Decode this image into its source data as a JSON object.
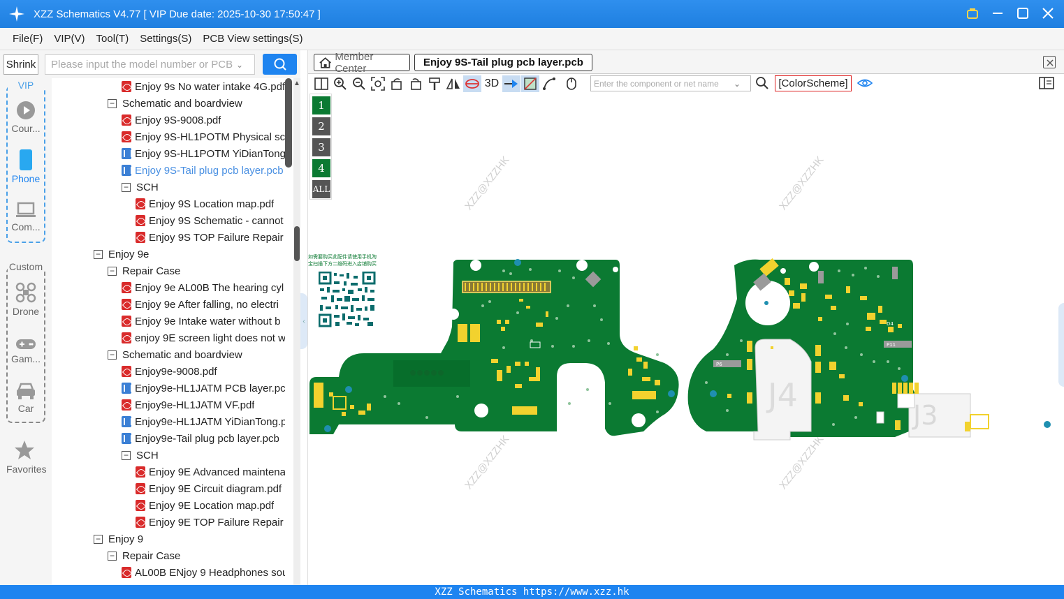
{
  "window": {
    "title": "XZZ Schematics V4.77 [ VIP Due date: 2025-10-30 17:50:47 ]"
  },
  "menu": [
    "File(F)",
    "VIP(V)",
    "Tool(T)",
    "Settings(S)",
    "PCB View settings(S)"
  ],
  "left_top": {
    "shrink_label": "Shrink",
    "search_placeholder": "Please input the model number or PCB"
  },
  "sidebar": {
    "vip_label": "VIP",
    "custom_label": "Custom",
    "items": [
      {
        "label": "Cour...",
        "icon": "play-icon"
      },
      {
        "label": "Phone",
        "icon": "phone-icon"
      },
      {
        "label": "Com...",
        "icon": "laptop-icon"
      },
      {
        "label": "Drone",
        "icon": "drone-icon"
      },
      {
        "label": "Gam...",
        "icon": "gamepad-icon"
      },
      {
        "label": "Car",
        "icon": "car-icon"
      },
      {
        "label": "Favorites",
        "icon": "star-icon"
      }
    ]
  },
  "tree": [
    {
      "level": 2,
      "type": "pdf",
      "label": "Enjoy 9s No water intake 4G.pdf"
    },
    {
      "level": 1,
      "type": "folder",
      "label": "Schematic and boardview"
    },
    {
      "level": 2,
      "type": "pdf",
      "label": "Enjoy 9S-9008.pdf"
    },
    {
      "level": 2,
      "type": "pdf",
      "label": "Enjoy 9S-HL1POTM Physical sca"
    },
    {
      "level": 2,
      "type": "pcb",
      "label": "Enjoy 9S-HL1POTM YiDianTong"
    },
    {
      "level": 2,
      "type": "pcb",
      "label": "Enjoy 9S-Tail plug pcb layer.pcb",
      "selected": true
    },
    {
      "level": 2,
      "type": "folder",
      "label": "SCH"
    },
    {
      "level": 3,
      "type": "pdf",
      "label": "Enjoy 9S Location map.pdf"
    },
    {
      "level": 3,
      "type": "pdf",
      "label": "Enjoy 9S Schematic - cannot"
    },
    {
      "level": 3,
      "type": "pdf",
      "label": "Enjoy 9S TOP  Failure Repair"
    },
    {
      "level": 0,
      "type": "folder",
      "label": "Enjoy 9e"
    },
    {
      "level": 1,
      "type": "folder",
      "label": "Repair Case"
    },
    {
      "level": 2,
      "type": "pdf",
      "label": "Enjoy 9e AL00B The hearing cyl"
    },
    {
      "level": 2,
      "type": "pdf",
      "label": "Enjoy 9e After falling, no electri"
    },
    {
      "level": 2,
      "type": "pdf",
      "label": "Enjoy 9e Intake water without b"
    },
    {
      "level": 2,
      "type": "pdf",
      "label": "enjoy 9E screen light does not w"
    },
    {
      "level": 1,
      "type": "folder",
      "label": "Schematic and boardview"
    },
    {
      "level": 2,
      "type": "pdf",
      "label": "Enjoy9e-9008.pdf"
    },
    {
      "level": 2,
      "type": "pcb",
      "label": "Enjoy9e-HL1JATM PCB layer.pcb"
    },
    {
      "level": 2,
      "type": "pdf",
      "label": "Enjoy9e-HL1JATM VF.pdf"
    },
    {
      "level": 2,
      "type": "pcb",
      "label": "Enjoy9e-HL1JATM YiDianTong.pcb"
    },
    {
      "level": 2,
      "type": "pcb",
      "label": "Enjoy9e-Tail plug pcb layer.pcb"
    },
    {
      "level": 2,
      "type": "folder",
      "label": "SCH"
    },
    {
      "level": 3,
      "type": "pdf",
      "label": "Enjoy 9E Advanced maintena"
    },
    {
      "level": 3,
      "type": "pdf",
      "label": "Enjoy 9E Circuit diagram.pdf"
    },
    {
      "level": 3,
      "type": "pdf",
      "label": "Enjoy 9E Location map.pdf"
    },
    {
      "level": 3,
      "type": "pdf",
      "label": "Enjoy 9E TOP Failure Repair G"
    },
    {
      "level": 0,
      "type": "folder",
      "label": "Enjoy 9"
    },
    {
      "level": 1,
      "type": "folder",
      "label": "Repair Case"
    },
    {
      "level": 2,
      "type": "pdf",
      "label": "AL00B ENjoy 9 Headphones sou"
    }
  ],
  "tabs": {
    "member_center": "Member Center",
    "active_file": "Enjoy 9S-Tail plug pcb layer.pcb"
  },
  "toolbar": {
    "three_d": "3D",
    "component_placeholder": "Enter the component or net name",
    "color_scheme": "[ColorScheme]"
  },
  "layers": [
    "1",
    "2",
    "3",
    "4",
    "ALL"
  ],
  "board": {
    "qr_caption": "如需要购买此配件请使用手机淘宝扫描下方二维码进入店铺购买",
    "watermark": "XZZ@XZZHK",
    "labels": [
      "J4",
      "J3",
      "P11",
      "P6",
      "U4",
      "D4"
    ]
  },
  "status": "XZZ Schematics https://www.xzz.hk",
  "colors": {
    "accent": "#1e84f0",
    "pcb_green": "#0b7a32",
    "pad_yellow": "#f2d22e"
  }
}
